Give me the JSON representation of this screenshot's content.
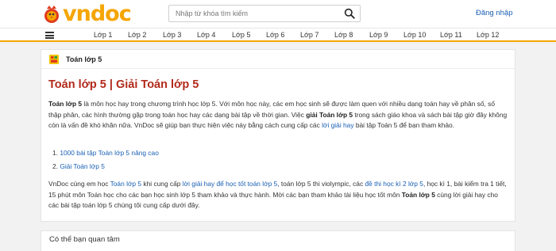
{
  "header": {
    "logo_text": "vndoc",
    "search_placeholder": "Nhập từ khóa tìm kiếm",
    "login_label": "Đăng nhập"
  },
  "nav": {
    "items": [
      "Lớp 1",
      "Lớp 2",
      "Lớp 3",
      "Lớp 4",
      "Lớp 5",
      "Lớp 6",
      "Lớp 7",
      "Lớp 8",
      "Lớp 9",
      "Lớp 10",
      "Lớp 11",
      "Lớp 12"
    ]
  },
  "breadcrumb": {
    "label": "Toán lớp 5"
  },
  "article": {
    "title": "Toán lớp 5 | Giải Toán lớp 5",
    "p1": {
      "bold_start": "Toán lớp 5",
      "text1": " là môn học hay trong chương trình học lớp 5. Với môn học này, các em học sinh sẽ được làm quen với nhiều dạng toán hay về phân số, số thập phân, các hình thường gặp trong toán học hay các dạng bài tập về thời gian. Việc ",
      "bold_mid": "giải Toán lớp 5",
      "text2": " trong sách giáo khoa và sách bài tập giờ đây không còn là vấn đề khó khăn nữa. VnDoc sẽ giúp bạn thực hiện việc này bằng cách cung cấp các ",
      "link": "lời giải hay",
      "text3": " bài tập Toán 5 để bạn tham khảo."
    },
    "list": [
      {
        "num": "1.",
        "label": "1000 bài tập Toán lớp 5 nâng cao"
      },
      {
        "num": "2.",
        "label": "Giải Toán lớp 5"
      }
    ],
    "p2": {
      "t1": "VnDoc cùng em học ",
      "l1": "Toán lớp 5",
      "t2": " khi cung cấp ",
      "l2": "lời giải hay để học tốt toán lớp 5",
      "t3": ", toán lớp 5 thi violympic, các ",
      "l3": "đề thi học kì 2 lớp 5",
      "t4": ", học kì 1, bài kiểm tra 1 tiết, 15 phút môn Toán học cho các bạn học sinh lớp 5 tham khảo và thực hành. Mời các bạn tham khảo tài liệu học tốt môn ",
      "b1": "Toán lớp 5",
      "t5": " cùng lời giải hay cho các bài tập toán lớp 5 chúng tôi cung cấp dưới đây."
    }
  },
  "related": {
    "title": "Có thể bạn quan tâm"
  }
}
